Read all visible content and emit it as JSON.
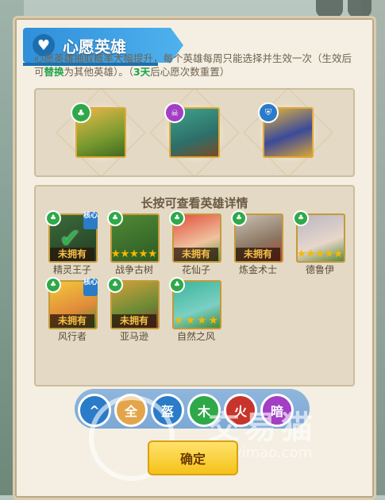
{
  "banner": {
    "title": "心愿英雄"
  },
  "description": {
    "part1": "心愿英雄抽取概率大幅提升，每个英雄每周只能选择并生效一次（生效后可",
    "highlight1": "替换",
    "part2": "为其他英雄）。（",
    "highlight2": "3天",
    "part3": "后心愿次数重置）"
  },
  "wish_slots": [
    {
      "faction": "forest",
      "badge_color": "#2fa84a"
    },
    {
      "faction": "dark",
      "badge_color": "#a23fc4"
    },
    {
      "faction": "fortress",
      "badge_color": "#2a7bc8"
    }
  ],
  "pool": {
    "title": "长按可查看英雄详情",
    "owned_text": "未拥有",
    "core_text": "核心",
    "heroes": [
      {
        "name": "精灵王子",
        "status": "未拥有",
        "selected": true,
        "core": true,
        "stars": 0
      },
      {
        "name": "战争古树",
        "status": "",
        "selected": false,
        "core": false,
        "stars": 5
      },
      {
        "name": "花仙子",
        "status": "未拥有",
        "selected": false,
        "core": false,
        "stars": 0
      },
      {
        "name": "炼金术士",
        "status": "未拥有",
        "selected": false,
        "core": false,
        "stars": 0
      },
      {
        "name": "德鲁伊",
        "status": "",
        "selected": false,
        "core": false,
        "stars": 5
      },
      {
        "name": "风行者",
        "status": "未拥有",
        "selected": false,
        "core": true,
        "stars": 0
      },
      {
        "name": "亚马逊",
        "status": "未拥有",
        "selected": false,
        "core": false,
        "stars": 0
      },
      {
        "name": "自然之风",
        "status": "",
        "selected": false,
        "core": false,
        "stars": 4
      }
    ]
  },
  "filters": [
    {
      "icon": "chevron-up-icon",
      "glyph": "^",
      "color": "#2a7bc8"
    },
    {
      "icon": "all-icon",
      "glyph": "全",
      "color": "#e3a54a"
    },
    {
      "icon": "helmet-icon",
      "glyph": "盔",
      "color": "#2a7bc8"
    },
    {
      "icon": "tree-icon",
      "glyph": "木",
      "color": "#2fa84a"
    },
    {
      "icon": "flame-icon",
      "glyph": "火",
      "color": "#c7342c"
    },
    {
      "icon": "skull-icon",
      "glyph": "暗",
      "color": "#a23fc4"
    }
  ],
  "confirm": {
    "label": "确定"
  },
  "watermark": {
    "text": "交易猫",
    "url": "jiaoyimao.com"
  }
}
